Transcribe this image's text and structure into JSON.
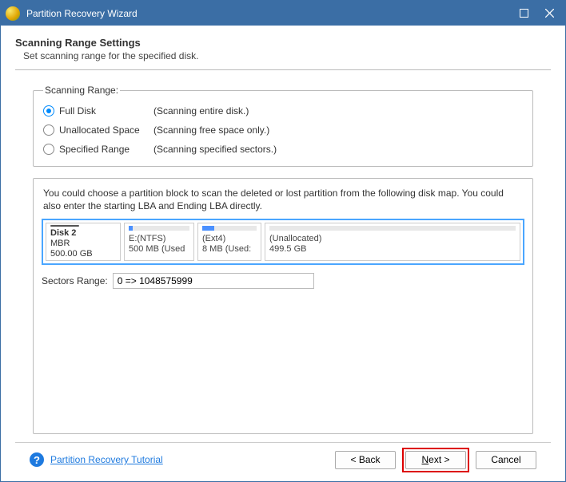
{
  "titlebar": {
    "title": "Partition Recovery Wizard"
  },
  "header": {
    "heading": "Scanning Range Settings",
    "sub": "Set scanning range for the specified disk."
  },
  "scanning_range": {
    "legend": "Scanning Range:",
    "options": [
      {
        "label": "Full Disk",
        "desc": "(Scanning entire disk.)",
        "checked": true
      },
      {
        "label": "Unallocated Space",
        "desc": "(Scanning free space only.)",
        "checked": false
      },
      {
        "label": "Specified Range",
        "desc": "(Scanning specified sectors.)",
        "checked": false
      }
    ]
  },
  "diskmap": {
    "intro": "You could choose a partition block to scan the deleted or lost partition from the following disk map. You could also enter the starting LBA and Ending LBA directly.",
    "disk": {
      "name": "Disk 2",
      "scheme": "MBR",
      "size": "500.00 GB"
    },
    "partitions": [
      {
        "label": "E:(NTFS)",
        "detail": "500 MB (Used"
      },
      {
        "label": "(Ext4)",
        "detail": "8 MB (Used: "
      },
      {
        "label": "(Unallocated)",
        "detail": "499.5 GB"
      }
    ]
  },
  "sectors": {
    "label": "Sectors Range:",
    "value": "0 => 1048575999"
  },
  "footer": {
    "tutorial": "Partition Recovery Tutorial",
    "back": "< Back",
    "next": "ext >",
    "next_prefix": "N",
    "cancel": "Cancel"
  }
}
